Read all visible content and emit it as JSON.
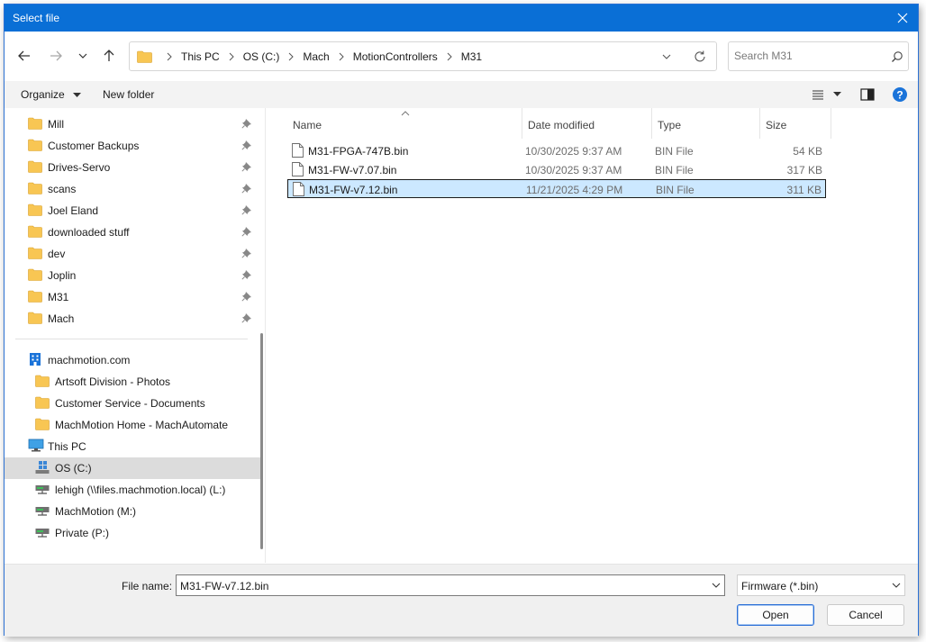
{
  "window": {
    "title": "Select file"
  },
  "nav": {
    "breadcrumbs": [
      "This PC",
      "OS (C:)",
      "Mach",
      "MotionControllers",
      "M31"
    ],
    "search_placeholder": "Search M31"
  },
  "command_bar": {
    "organize_label": "Organize",
    "new_folder_label": "New folder"
  },
  "sidebar": {
    "quick_access": [
      {
        "label": "Mill"
      },
      {
        "label": "Customer Backups"
      },
      {
        "label": "Drives-Servo"
      },
      {
        "label": "scans"
      },
      {
        "label": "Joel Eland"
      },
      {
        "label": "downloaded stuff"
      },
      {
        "label": "dev"
      },
      {
        "label": "Joplin"
      },
      {
        "label": "M31"
      },
      {
        "label": "Mach"
      }
    ],
    "org": {
      "label": "machmotion.com",
      "items": [
        {
          "label": "Artsoft Division - Photos"
        },
        {
          "label": "Customer Service - Documents"
        },
        {
          "label": "MachMotion Home - MachAutomate"
        }
      ]
    },
    "this_pc": {
      "label": "This PC",
      "drives": [
        {
          "label": "OS (C:)"
        },
        {
          "label": "lehigh (\\\\files.machmotion.local) (L:)"
        },
        {
          "label": "MachMotion (M:)"
        },
        {
          "label": "Private (P:)"
        }
      ]
    }
  },
  "file_list": {
    "columns": {
      "name": "Name",
      "date": "Date modified",
      "type": "Type",
      "size": "Size"
    },
    "rows": [
      {
        "name": "M31-FPGA-747B.bin",
        "date": "10/30/2025 9:37 AM",
        "type": "BIN File",
        "size": "54 KB"
      },
      {
        "name": "M31-FW-v7.07.bin",
        "date": "10/30/2025 9:37 AM",
        "type": "BIN File",
        "size": "317 KB"
      },
      {
        "name": "M31-FW-v7.12.bin",
        "date": "11/21/2025 4:29 PM",
        "type": "BIN File",
        "size": "311 KB"
      }
    ]
  },
  "footer": {
    "file_name_label": "File name:",
    "file_name_value": "M31-FW-v7.12.bin",
    "file_type_value": "Firmware (*.bin)",
    "open_label": "Open",
    "cancel_label": "Cancel"
  },
  "colors": {
    "titlebar": "#0a6fd6",
    "selection": "#cce8ff",
    "folder": "#f8c653",
    "help": "#1a73d9"
  }
}
